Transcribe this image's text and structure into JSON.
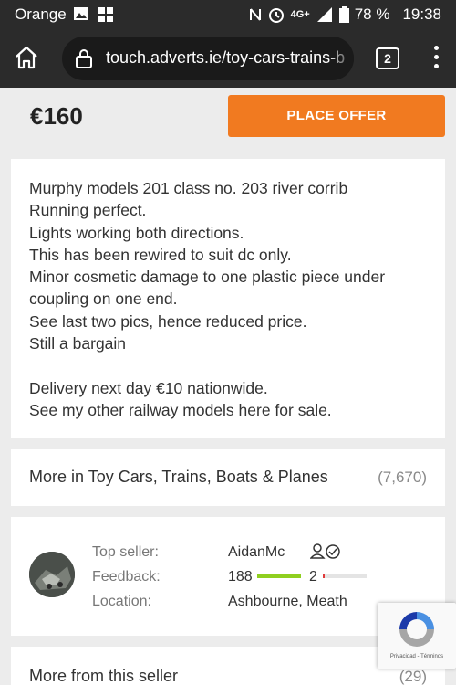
{
  "status_bar": {
    "carrier": "Orange",
    "network": "4G+",
    "battery": "78 %",
    "time": "19:38"
  },
  "browser": {
    "url": "touch.adverts.ie/toy-cars-trains-bo",
    "tab_count": "2"
  },
  "listing": {
    "price": "€160",
    "offer_button": "PLACE OFFER",
    "description_lines": [
      "Murphy models 201 class no. 203 river corrib",
      "Running perfect.",
      "Lights working both directions.",
      "This has been rewired to suit dc only.",
      "Minor cosmetic damage to one plastic piece under",
      "coupling on one end.",
      "See last two pics, hence reduced price.",
      "Still a bargain",
      "",
      "Delivery next day €10 nationwide.",
      "See my other railway models here for sale."
    ]
  },
  "more_in": {
    "label": "More in Toy Cars, Trains, Boats & Planes",
    "count": "(7,670)"
  },
  "seller": {
    "top_seller_label": "Top seller:",
    "name": "AidanMc",
    "feedback_label": "Feedback:",
    "positive": "188",
    "negative": "2",
    "positive_fraction": 0.99,
    "location_label": "Location:",
    "location": "Ashbourne, Meath"
  },
  "more_from_seller": {
    "label": "More from this seller",
    "count": "(29)"
  },
  "recaptcha": {
    "links": "Privacidad - Términos"
  },
  "colors": {
    "accent": "#f17a20",
    "positive_bar": "#8fcf1f",
    "negative_bar": "#e03b3b"
  }
}
